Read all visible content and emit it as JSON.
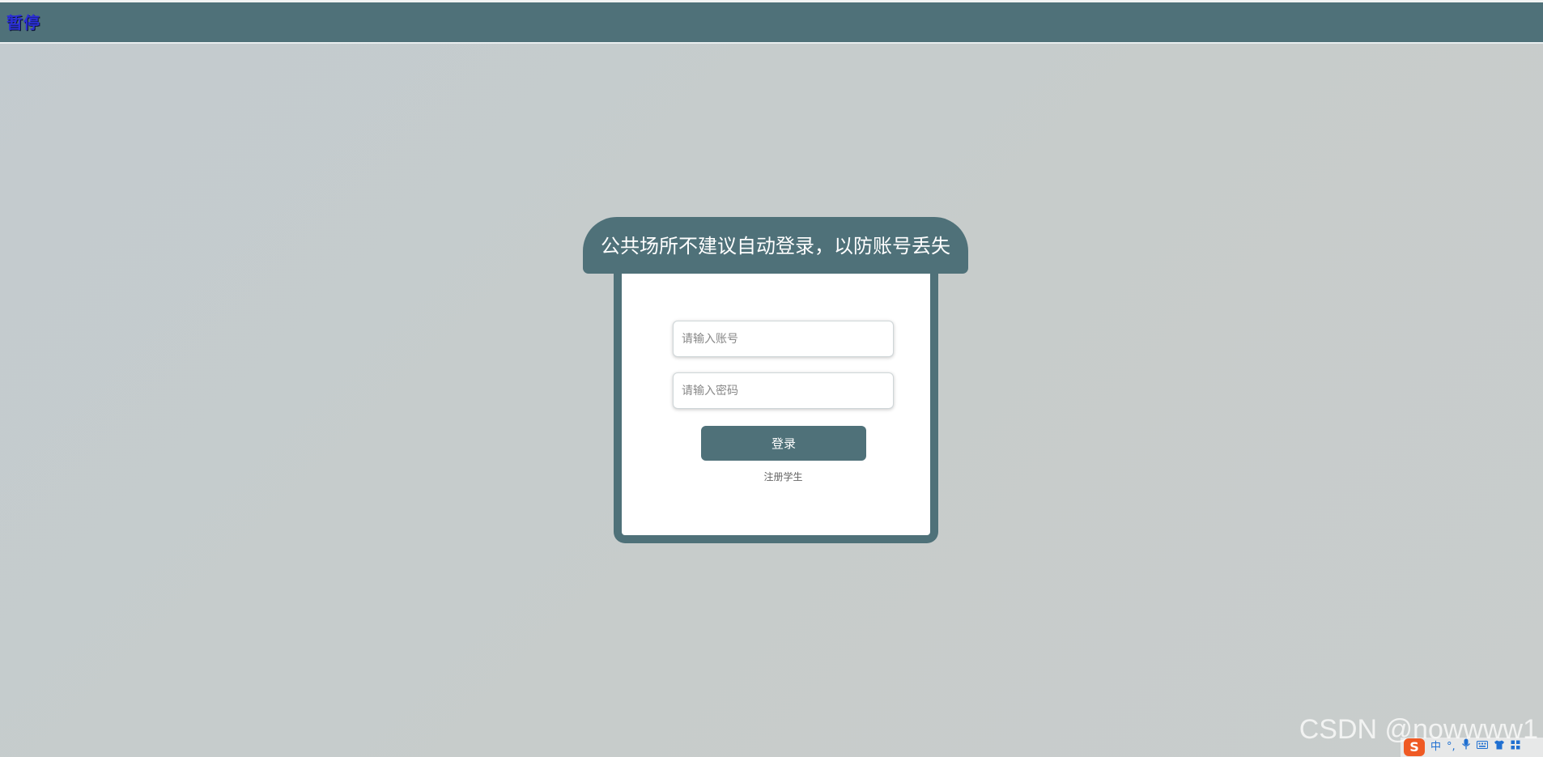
{
  "topbar": {
    "pause_label": "暂停"
  },
  "login": {
    "header_text": "公共场所不建议自动登录，以防账号丢失",
    "account_placeholder": "请输入账号",
    "password_placeholder": "请输入密码",
    "login_button": "登录",
    "register_link": "注册学生"
  },
  "watermark": {
    "text": "CSDN @nowwww1"
  },
  "ime_toolbar": {
    "logo": "S",
    "mode": "中",
    "punct": "°,",
    "icons": [
      "mic-icon",
      "keyboard-icon",
      "shirt-icon",
      "grid-icon"
    ]
  },
  "colors": {
    "primary": "#4f7179",
    "background": "#c5cccd",
    "card": "#ffffff"
  }
}
